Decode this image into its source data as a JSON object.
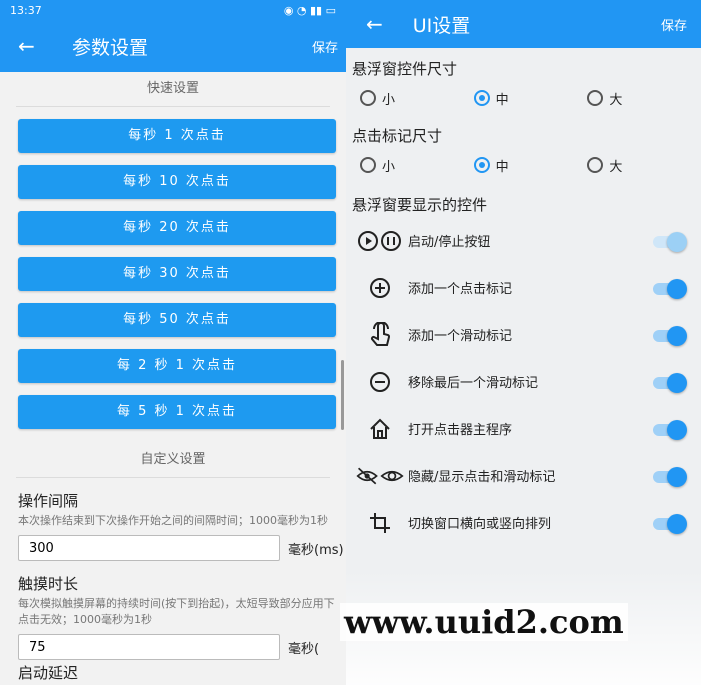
{
  "left": {
    "status": {
      "time": "13:37"
    },
    "appbar": {
      "title": "参数设置",
      "save": "保存"
    },
    "quick_title": "快速设置",
    "quick_buttons": [
      "每秒 1 次点击",
      "每秒 10 次点击",
      "每秒 20 次点击",
      "每秒 30 次点击",
      "每秒 50 次点击",
      "每 2 秒 1 次点击",
      "每 5 秒 1 次点击"
    ],
    "custom_title": "自定义设置",
    "interval": {
      "label": "操作间隔",
      "desc": "本次操作结束到下次操作开始之间的间隔时间；1000毫秒为1秒",
      "value": "300",
      "unit": "毫秒(ms)"
    },
    "touch": {
      "label": "触摸时长",
      "desc": "每次模拟触摸屏幕的持续时间(按下到抬起)，太短导致部分应用下点击无效；1000毫秒为1秒",
      "value": "75",
      "unit": "毫秒("
    },
    "next_label": "启动延迟"
  },
  "right": {
    "appbar": {
      "title": "UI设置",
      "save": "保存"
    },
    "widget_size": {
      "label": "悬浮窗控件尺寸",
      "options": [
        "小",
        "中",
        "大"
      ],
      "selected": "中"
    },
    "mark_size": {
      "label": "点击标记尺寸",
      "options": [
        "小",
        "中",
        "大"
      ],
      "selected": "中"
    },
    "controls_label": "悬浮窗要显示的控件",
    "controls": [
      {
        "text": "启动/停止按钮",
        "icon": "play-pause-icon",
        "on": true
      },
      {
        "text": "添加一个点击标记",
        "icon": "plus-circle-icon",
        "on": true
      },
      {
        "text": "添加一个滑动标记",
        "icon": "swipe-hand-icon",
        "on": true
      },
      {
        "text": "移除最后一个滑动标记",
        "icon": "minus-circle-icon",
        "on": true
      },
      {
        "text": "打开点击器主程序",
        "icon": "home-icon",
        "on": true
      },
      {
        "text": "隐藏/显示点击和滑动标记",
        "icon": "eye-toggle-icon",
        "on": true
      },
      {
        "text": "切换窗口横向或竖向排列",
        "icon": "crop-rotate-icon",
        "on": true
      }
    ]
  },
  "watermark": "www.uuid2.com",
  "colors": {
    "primary": "#2196f3",
    "button": "#1e9af0"
  }
}
